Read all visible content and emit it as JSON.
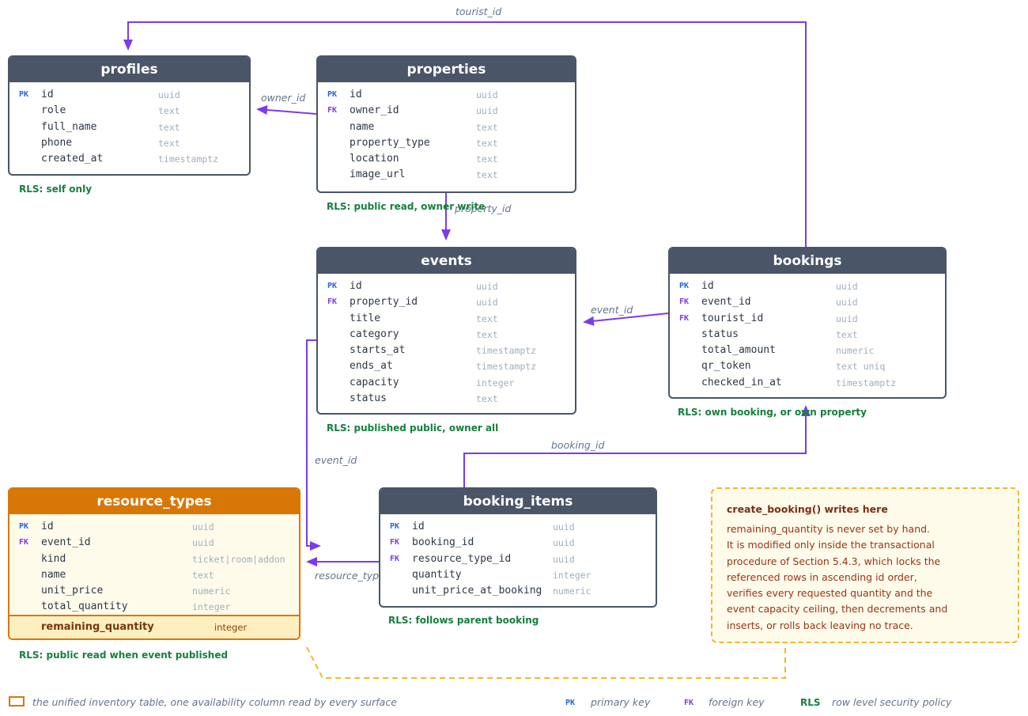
{
  "tables": {
    "profiles": {
      "title": "profiles",
      "columns": [
        {
          "key": "PK",
          "name": "id",
          "type": "uuid"
        },
        {
          "key": "",
          "name": "role",
          "type": "text"
        },
        {
          "key": "",
          "name": "full_name",
          "type": "text"
        },
        {
          "key": "",
          "name": "phone",
          "type": "text"
        },
        {
          "key": "",
          "name": "created_at",
          "type": "timestamptz"
        }
      ],
      "rls": "RLS: self only"
    },
    "properties": {
      "title": "properties",
      "columns": [
        {
          "key": "PK",
          "name": "id",
          "type": "uuid"
        },
        {
          "key": "FK",
          "name": "owner_id",
          "type": "uuid"
        },
        {
          "key": "",
          "name": "name",
          "type": "text"
        },
        {
          "key": "",
          "name": "property_type",
          "type": "text"
        },
        {
          "key": "",
          "name": "location",
          "type": "text"
        },
        {
          "key": "",
          "name": "image_url",
          "type": "text"
        }
      ],
      "rls": "RLS: public read, owner write"
    },
    "events": {
      "title": "events",
      "columns": [
        {
          "key": "PK",
          "name": "id",
          "type": "uuid"
        },
        {
          "key": "FK",
          "name": "property_id",
          "type": "uuid"
        },
        {
          "key": "",
          "name": "title",
          "type": "text"
        },
        {
          "key": "",
          "name": "category",
          "type": "text"
        },
        {
          "key": "",
          "name": "starts_at",
          "type": "timestamptz"
        },
        {
          "key": "",
          "name": "ends_at",
          "type": "timestamptz"
        },
        {
          "key": "",
          "name": "capacity",
          "type": "integer"
        },
        {
          "key": "",
          "name": "status",
          "type": "text"
        }
      ],
      "rls": "RLS: published public, owner all"
    },
    "bookings": {
      "title": "bookings",
      "columns": [
        {
          "key": "PK",
          "name": "id",
          "type": "uuid"
        },
        {
          "key": "FK",
          "name": "event_id",
          "type": "uuid"
        },
        {
          "key": "FK",
          "name": "tourist_id",
          "type": "uuid"
        },
        {
          "key": "",
          "name": "status",
          "type": "text"
        },
        {
          "key": "",
          "name": "total_amount",
          "type": "numeric"
        },
        {
          "key": "",
          "name": "qr_token",
          "type": "text uniq"
        },
        {
          "key": "",
          "name": "checked_in_at",
          "type": "timestamptz"
        }
      ],
      "rls": "RLS: own booking, or own property"
    },
    "resource_types": {
      "title": "resource_types",
      "columns": [
        {
          "key": "PK",
          "name": "id",
          "type": "uuid"
        },
        {
          "key": "FK",
          "name": "event_id",
          "type": "uuid"
        },
        {
          "key": "",
          "name": "kind",
          "type": "ticket|room|addon"
        },
        {
          "key": "",
          "name": "name",
          "type": "text"
        },
        {
          "key": "",
          "name": "unit_price",
          "type": "numeric"
        },
        {
          "key": "",
          "name": "total_quantity",
          "type": "integer"
        }
      ],
      "highlight": {
        "name": "remaining_quantity",
        "type": "integer"
      },
      "rls": "RLS: public read when event published"
    },
    "booking_items": {
      "title": "booking_items",
      "columns": [
        {
          "key": "PK",
          "name": "id",
          "type": "uuid"
        },
        {
          "key": "FK",
          "name": "booking_id",
          "type": "uuid"
        },
        {
          "key": "FK",
          "name": "resource_type_id",
          "type": "uuid"
        },
        {
          "key": "",
          "name": "quantity",
          "type": "integer"
        },
        {
          "key": "",
          "name": "unit_price_at_booking",
          "type": "numeric"
        }
      ],
      "rls": "RLS: follows parent booking"
    }
  },
  "edges": {
    "tourist_id": "tourist_id",
    "owner_id": "owner_id",
    "property_id": "property_id",
    "event_id_bookings": "event_id",
    "event_id_resource": "event_id",
    "booking_id": "booking_id",
    "resource_type_id": "resource_type_id"
  },
  "note": {
    "title": "create_booking() writes here",
    "lines": [
      "remaining_quantity is never set by hand.",
      "It is modified only inside the transactional",
      "procedure of Section 5.4.3, which locks the",
      "referenced rows in ascending id order,",
      "verifies every requested quantity and the",
      "event capacity ceiling, then decrements and",
      "inserts, or rolls back leaving no trace."
    ]
  },
  "legend": {
    "inventory": "the unified inventory table, one availability column read by every surface",
    "pk_badge": "PK",
    "pk_text": "primary key",
    "fk_badge": "FK",
    "fk_text": "foreign key",
    "rls_badge": "RLS",
    "rls_text": "row level security policy"
  },
  "colors": {
    "edge": "#7c3aed",
    "header": "#4a5568",
    "accent": "#d97706",
    "rls": "#15803d",
    "note_border": "#f2b822"
  }
}
